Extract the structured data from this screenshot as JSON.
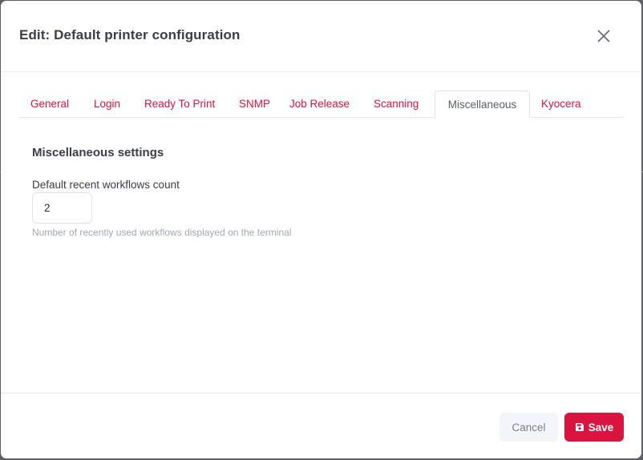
{
  "dialog": {
    "title": "Edit: Default printer configuration"
  },
  "tabs": [
    {
      "label": "General",
      "active": false
    },
    {
      "label": "Login",
      "active": false
    },
    {
      "label": "Ready To Print",
      "active": false
    },
    {
      "label": "SNMP",
      "active": false
    },
    {
      "label": "Job Release",
      "active": false
    },
    {
      "label": "Scanning",
      "active": false
    },
    {
      "label": "Miscellaneous",
      "active": true
    },
    {
      "label": "Kyocera",
      "active": false
    }
  ],
  "section": {
    "title": "Miscellaneous settings",
    "field_label": "Default recent workflows count",
    "field_value": "2",
    "help_text": "Number of recently used workflows displayed on the terminal"
  },
  "footer": {
    "cancel_label": "Cancel",
    "save_label": "Save"
  },
  "icons": {
    "close": "close-icon",
    "save": "floppy-disk-icon"
  },
  "colors": {
    "accent": "#d9143e",
    "title_text": "#3b3e45",
    "muted_text": "#a3a7b0",
    "cancel_bg": "#f3f5f8"
  }
}
